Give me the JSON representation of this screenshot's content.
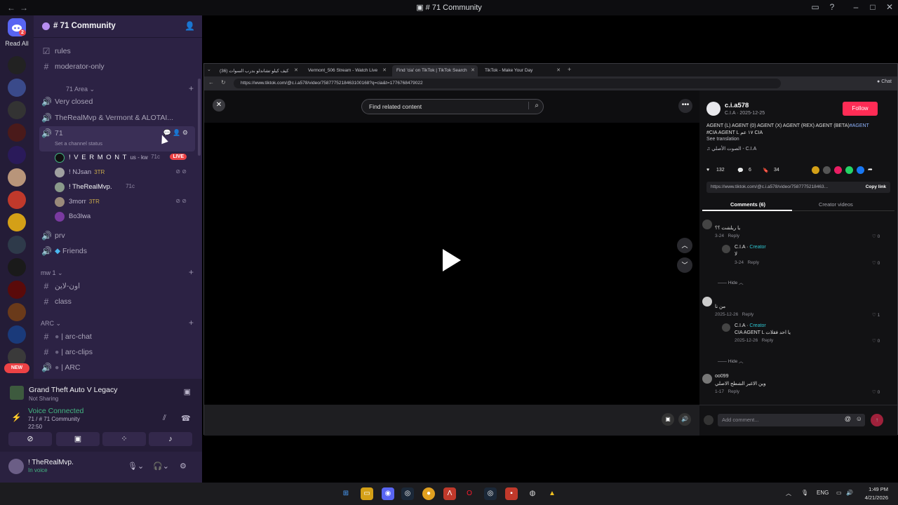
{
  "window": {
    "title": "# 71 Community",
    "back_icon": "arrow-left-icon",
    "forward_icon": "arrow-right-icon",
    "inbox_icon": "inbox-icon",
    "help_icon": "help-icon",
    "min_icon": "minimize-icon",
    "max_icon": "maximize-icon",
    "close_icon": "close-icon"
  },
  "rail": {
    "home_badge": "2",
    "read_all": "Read All",
    "new_badge": "NEW",
    "server_badge": "1"
  },
  "server": {
    "name": "# 71 Community"
  },
  "channels": {
    "rules": "rules",
    "moderator_only": "moderator-only",
    "category_71": "71 Area",
    "very_closed": "Very closed",
    "realmvp_vermont": "TheRealMvp & Vermont & ALOTAI...",
    "ch71": "71",
    "set_status": "Set a channel status",
    "prv": "prv",
    "friends": "Friends",
    "category_mw": "mw 1",
    "arabic_channel": "اون-لاين",
    "class": "class",
    "category_arc": "ARC",
    "arc_chat": "| arc-chat",
    "arc_clips": "| arc-clips",
    "arc": "| ARC"
  },
  "voice_users": [
    {
      "name": "! V E R M O N T",
      "tag": "us - kw",
      "right": "71c",
      "live": "LIVE"
    },
    {
      "name": "! NJsan",
      "tag": "3TR",
      "right": ""
    },
    {
      "name": "! TheRealMvp.",
      "tag": "",
      "right": "71c"
    },
    {
      "name": "3morr",
      "tag": "3TR",
      "right": ""
    },
    {
      "name": "Bo3lwa",
      "tag": "",
      "right": ""
    }
  ],
  "activity": {
    "title": "Grand Theft Auto V Legacy",
    "sub": "Not Sharing"
  },
  "voice": {
    "status": "Voice Connected",
    "channel": "71 / # 71 Community",
    "time": "22:50"
  },
  "user": {
    "name": "! TheRealMvp.",
    "status": "In voice"
  },
  "browser": {
    "tabs": [
      {
        "label": "كيف كيلو تشاندلو بدرب السوات (36)"
      },
      {
        "label": "Vermont_506 Stream - Watch Live"
      },
      {
        "label": "Find 'cia' on TikTok | TikTok Search"
      },
      {
        "label": "TikTok - Make Your Day"
      }
    ],
    "url": "https://www.tiktok.com/@c.i.a578/video/7587775218463100168?q=cia&t=1776768479022",
    "chat_label": "Chat"
  },
  "video": {
    "search_placeholder": "Find related content",
    "close_icon": "x-icon",
    "more_icon": "more-dots-icon"
  },
  "post": {
    "username": "c.i.a578",
    "meta": "C.I.A · 2025-12-25",
    "follow": "Follow",
    "desc_line1": "AGENT (L) AGENT (0) AGENT (X) AGENT (REX) AGENT (BETA)",
    "desc_hashtag": "#AGENT",
    "desc_line2": "#CIA AGENT L ١٧ عم CIA",
    "see_translation": "See translation",
    "music": "الصوت الأصلي - C.I.A",
    "likes": "132",
    "comments": "6",
    "saves": "34",
    "link": "https://www.tiktok.com/@c.i.a578/video/7587775218463...",
    "copy_link": "Copy link",
    "tab_comments": "Comments (6)",
    "tab_creator": "Creator videos"
  },
  "comments": [
    {
      "text": "يا ريلشت ؟؟",
      "date": "3-24",
      "reply": "Reply",
      "likes": "0"
    },
    {
      "author": "C.I.A",
      "creator": "Creator",
      "text": "لا",
      "date": "3-24",
      "reply": "Reply",
      "likes": "0"
    },
    {
      "text": "من نا",
      "date": "2025-12-26",
      "reply": "Reply",
      "likes": "1"
    },
    {
      "author": "C.I.A",
      "creator": "Creator",
      "text": "CIA AGENT L يا احد فقلات",
      "date": "2025-12-26",
      "reply": "Reply",
      "likes": "0"
    },
    {
      "author": "oo099",
      "text": "وين الاغبر الشطح الاصلي",
      "date": "1-17",
      "reply": "Reply",
      "likes": "0"
    }
  ],
  "hide_label": "Hide",
  "add_comment": "Add comment...",
  "taskbar": {
    "lang": "ENG",
    "time": "1:49 PM",
    "date": "4/21/2026"
  }
}
